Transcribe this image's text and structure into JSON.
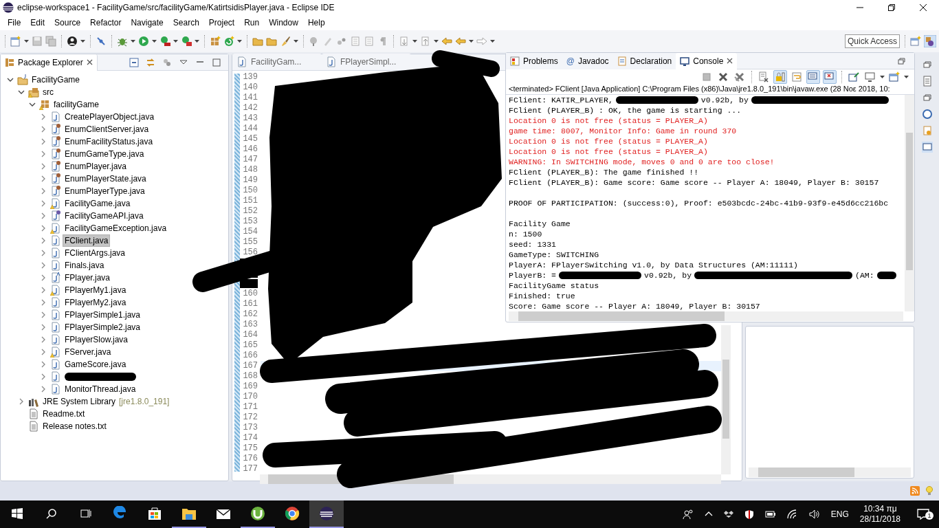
{
  "window": {
    "title": "eclipse-workspace1 - FacilityGame/src/facilityGame/KatirtsidisPlayer.java - Eclipse IDE"
  },
  "menu": [
    "File",
    "Edit",
    "Source",
    "Refactor",
    "Navigate",
    "Search",
    "Project",
    "Run",
    "Window",
    "Help"
  ],
  "quick_access": {
    "placeholder": "Quick Access"
  },
  "package_explorer": {
    "title": "Package Explorer",
    "items": [
      {
        "label": "FacilityGame",
        "kind": "project",
        "warning": false,
        "selected": false,
        "expanded": true,
        "children": [
          {
            "label": "src",
            "kind": "source",
            "warning": true,
            "selected": false,
            "expanded": true,
            "children": [
              {
                "label": "facilityGame",
                "kind": "package",
                "warning": true,
                "selected": false,
                "expanded": true,
                "children": [
                  {
                    "label": "CreatePlayerObject.java",
                    "kind": "class",
                    "warning": false,
                    "selected": false,
                    "expanded": false
                  },
                  {
                    "label": "EnumClientServer.java",
                    "kind": "enum",
                    "warning": false,
                    "selected": false,
                    "expanded": false
                  },
                  {
                    "label": "EnumFacilityStatus.java",
                    "kind": "enum",
                    "warning": false,
                    "selected": false,
                    "expanded": false
                  },
                  {
                    "label": "EnumGameType.java",
                    "kind": "enum",
                    "warning": false,
                    "selected": false,
                    "expanded": false
                  },
                  {
                    "label": "EnumPlayer.java",
                    "kind": "enum",
                    "warning": false,
                    "selected": false,
                    "expanded": false
                  },
                  {
                    "label": "EnumPlayerState.java",
                    "kind": "enum",
                    "warning": false,
                    "selected": false,
                    "expanded": false
                  },
                  {
                    "label": "EnumPlayerType.java",
                    "kind": "enum",
                    "warning": false,
                    "selected": false,
                    "expanded": false
                  },
                  {
                    "label": "FacilityGame.java",
                    "kind": "class",
                    "warning": true,
                    "selected": false,
                    "expanded": false
                  },
                  {
                    "label": "FacilityGameAPI.java",
                    "kind": "interface",
                    "warning": false,
                    "selected": false,
                    "expanded": false
                  },
                  {
                    "label": "FacilityGameException.java",
                    "kind": "class",
                    "warning": true,
                    "selected": false,
                    "expanded": false
                  },
                  {
                    "label": "FClient.java",
                    "kind": "class",
                    "warning": false,
                    "selected": true,
                    "expanded": false
                  },
                  {
                    "label": "FClientArgs.java",
                    "kind": "class",
                    "warning": false,
                    "selected": false,
                    "expanded": false
                  },
                  {
                    "label": "Finals.java",
                    "kind": "class",
                    "warning": false,
                    "selected": false,
                    "expanded": false
                  },
                  {
                    "label": "FPlayer.java",
                    "kind": "abstract",
                    "warning": false,
                    "selected": false,
                    "expanded": false
                  },
                  {
                    "label": "FPlayerMy1.java",
                    "kind": "class",
                    "warning": true,
                    "selected": false,
                    "expanded": false
                  },
                  {
                    "label": "FPlayerMy2.java",
                    "kind": "class",
                    "warning": false,
                    "selected": false,
                    "expanded": false
                  },
                  {
                    "label": "FPlayerSimple1.java",
                    "kind": "class",
                    "warning": false,
                    "selected": false,
                    "expanded": false
                  },
                  {
                    "label": "FPlayerSimple2.java",
                    "kind": "class",
                    "warning": false,
                    "selected": false,
                    "expanded": false
                  },
                  {
                    "label": "FPlayerSlow.java",
                    "kind": "class",
                    "warning": false,
                    "selected": false,
                    "expanded": false
                  },
                  {
                    "label": "FServer.java",
                    "kind": "class",
                    "warning": true,
                    "selected": false,
                    "expanded": false
                  },
                  {
                    "label": "GameScore.java",
                    "kind": "class",
                    "warning": false,
                    "selected": false,
                    "expanded": false
                  },
                  {
                    "kind": "class",
                    "redacted": true,
                    "warning": false,
                    "selected": false,
                    "expanded": false
                  },
                  {
                    "label": "MonitorThread.java",
                    "kind": "class",
                    "warning": false,
                    "selected": false,
                    "expanded": false
                  }
                ]
              }
            ]
          },
          {
            "label": "JRE System Library",
            "decoration": "[jre1.8.0_191]",
            "kind": "library",
            "warning": false,
            "selected": false,
            "expanded": false
          },
          {
            "label": "Readme.txt",
            "kind": "text",
            "warning": false,
            "selected": false
          },
          {
            "label": "Release notes.txt",
            "kind": "text",
            "warning": false,
            "selected": false
          }
        ]
      }
    ]
  },
  "editor": {
    "tabs": [
      {
        "label": "FacilityGam...",
        "selected": false
      },
      {
        "label": "FPlayerSimpl...",
        "selected": false
      }
    ],
    "lines": [
      {
        "number": "139",
        "current": false
      },
      {
        "number": "140",
        "current": false
      },
      {
        "number": "141",
        "current": false
      },
      {
        "number": "142",
        "current": false
      },
      {
        "number": "143",
        "current": false
      },
      {
        "number": "144",
        "current": false
      },
      {
        "number": "145",
        "current": false
      },
      {
        "number": "146",
        "current": false
      },
      {
        "number": "147",
        "current": false
      },
      {
        "number": "148",
        "current": false
      },
      {
        "number": "149",
        "current": false
      },
      {
        "number": "150",
        "current": false
      },
      {
        "number": "151",
        "current": false
      },
      {
        "number": "152",
        "current": false
      },
      {
        "number": "153",
        "current": false
      },
      {
        "number": "154",
        "current": false
      },
      {
        "number": "155",
        "current": false
      },
      {
        "number": "156",
        "current": false
      },
      {
        "kind": "covered",
        "current": false
      },
      {
        "kind": "covered",
        "current": false
      },
      {
        "kind": "covered",
        "current": false
      },
      {
        "number": "160",
        "current": false
      },
      {
        "number": "161",
        "current": false
      },
      {
        "number": "162",
        "current": false
      },
      {
        "number": "163",
        "current": false
      },
      {
        "number": "164",
        "current": false
      },
      {
        "number": "165",
        "current": false
      },
      {
        "number": "166",
        "current": false
      },
      {
        "number": "167",
        "current": true
      },
      {
        "number": "168",
        "current": false
      },
      {
        "number": "169",
        "current": false
      },
      {
        "number": "170",
        "current": false
      },
      {
        "number": "171",
        "current": false
      },
      {
        "number": "172",
        "current": false
      },
      {
        "number": "173",
        "current": false
      },
      {
        "number": "174",
        "current": false
      },
      {
        "number": "175",
        "current": false
      },
      {
        "number": "176",
        "current": false
      },
      {
        "number": "177",
        "current": false
      }
    ]
  },
  "console": {
    "tabs": [
      {
        "label": "Problems",
        "kind": "problems",
        "selected": false
      },
      {
        "label": "Javadoc",
        "kind": "javadoc",
        "glyph": "@",
        "selected": false
      },
      {
        "label": "Declaration",
        "kind": "declaration",
        "selected": false
      },
      {
        "label": "Console",
        "kind": "console",
        "selected": true
      }
    ],
    "toolbar": [
      {
        "kind": "stop",
        "pressed": false
      },
      {
        "kind": "remove",
        "pressed": false
      },
      {
        "kind": "remove-all",
        "pressed": false
      },
      {
        "kind": "clear",
        "pressed": false
      },
      {
        "kind": "scroll-lock",
        "pressed": true
      },
      {
        "kind": "word-wrap",
        "pressed": false
      },
      {
        "kind": "stdout",
        "pressed": true
      },
      {
        "kind": "stderr",
        "pressed": true
      },
      {
        "kind": "pin",
        "pressed": false
      },
      {
        "kind": "display",
        "pressed": false
      },
      {
        "kind": "new-console",
        "pressed": false
      }
    ],
    "header": "<terminated> FClient [Java Application] C:\\Program Files (x86)\\Java\\jre1.8.0_191\\bin\\javaw.exe (28 Νοε 2018, 10:",
    "lines": [
      {
        "kind": "out",
        "parts": [
          {
            "kind": "text",
            "text": "FClient: KATIR_PLAYER,"
          },
          {
            "kind": "redacted"
          },
          {
            "kind": "text",
            "text": "v0.92b, by"
          },
          {
            "kind": "redacted"
          }
        ]
      },
      {
        "kind": "out",
        "text": "FClient (PLAYER_B) : OK, the game is starting ..."
      },
      {
        "kind": "err",
        "text": "Location 0 is not free (status = PLAYER_A)"
      },
      {
        "kind": "err",
        "text": "game time: 8007, Monitor Info: Game in round 370"
      },
      {
        "kind": "err",
        "text": "Location 0 is not free (status = PLAYER_A)"
      },
      {
        "kind": "err",
        "text": "Location 0 is not free (status = PLAYER_A)"
      },
      {
        "kind": "err",
        "text": "WARNING: In SWITCHING mode, moves 0 and 0 are too close!"
      },
      {
        "kind": "out",
        "text": "FClient (PLAYER_B): The game finished !!"
      },
      {
        "kind": "out",
        "text": "FClient (PLAYER_B): Game score: Game score -- Player A: 18049, Player B: 30157"
      },
      {
        "kind": "blank"
      },
      {
        "kind": "out",
        "text": "PROOF OF PARTICIPATION: (success:0), Proof: e503bcdc-24bc-41b9-93f9-e45d6cc216bc"
      },
      {
        "kind": "blank"
      },
      {
        "kind": "out",
        "text": "Facility Game"
      },
      {
        "kind": "out",
        "text": "n: 1500"
      },
      {
        "kind": "out",
        "text": "seed: 1331"
      },
      {
        "kind": "out",
        "text": "GameType: SWITCHING"
      },
      {
        "kind": "out",
        "text": "PlayerA: FPlayerSwitching v1.0, by Data Structures (AM:11111)"
      },
      {
        "kind": "out",
        "parts": [
          {
            "kind": "text",
            "text": "PlayerB: ="
          },
          {
            "kind": "redacted"
          },
          {
            "kind": "text",
            "text": "v0.92b, by"
          },
          {
            "kind": "redacted"
          },
          {
            "kind": "text",
            "text": "(AM:"
          },
          {
            "kind": "redacted"
          }
        ]
      },
      {
        "kind": "out",
        "text": "FacilityGame status"
      },
      {
        "kind": "out",
        "text": "Finished: true"
      },
      {
        "kind": "out",
        "text": "Score: Game score -- Player A: 18049, Player B: 30157"
      }
    ]
  },
  "taskbar": {
    "apps": [
      {
        "kind": "edge",
        "running": false,
        "selected": false
      },
      {
        "kind": "store",
        "running": false,
        "selected": false
      },
      {
        "kind": "explorer",
        "running": true,
        "selected": false
      },
      {
        "kind": "mail",
        "running": false,
        "selected": false
      },
      {
        "kind": "utorrent",
        "running": true,
        "selected": false
      },
      {
        "kind": "chrome",
        "running": false,
        "selected": false
      },
      {
        "kind": "eclipse",
        "running": true,
        "selected": true
      }
    ],
    "language": "ENG",
    "time": "10:34 πμ",
    "date": "28/11/2018",
    "notifications": "1"
  }
}
